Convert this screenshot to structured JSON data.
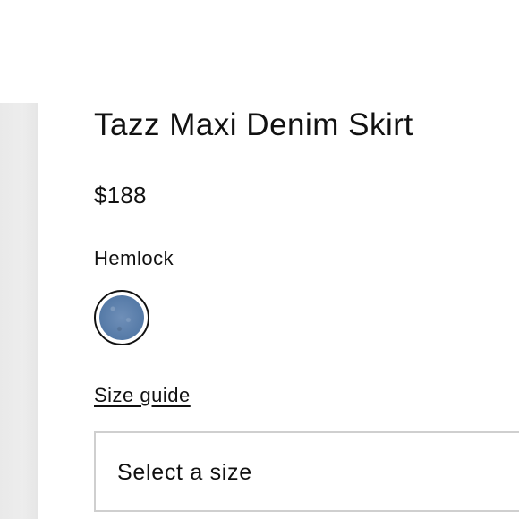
{
  "product": {
    "title": "Tazz Maxi Denim Skirt",
    "price": "$188",
    "color_name": "Hemlock"
  },
  "swatches": [
    {
      "color_name": "Hemlock",
      "color": "#557aa7",
      "selected": true
    }
  ],
  "links": {
    "size_guide": "Size guide"
  },
  "size_select": {
    "placeholder": "Select a size"
  }
}
